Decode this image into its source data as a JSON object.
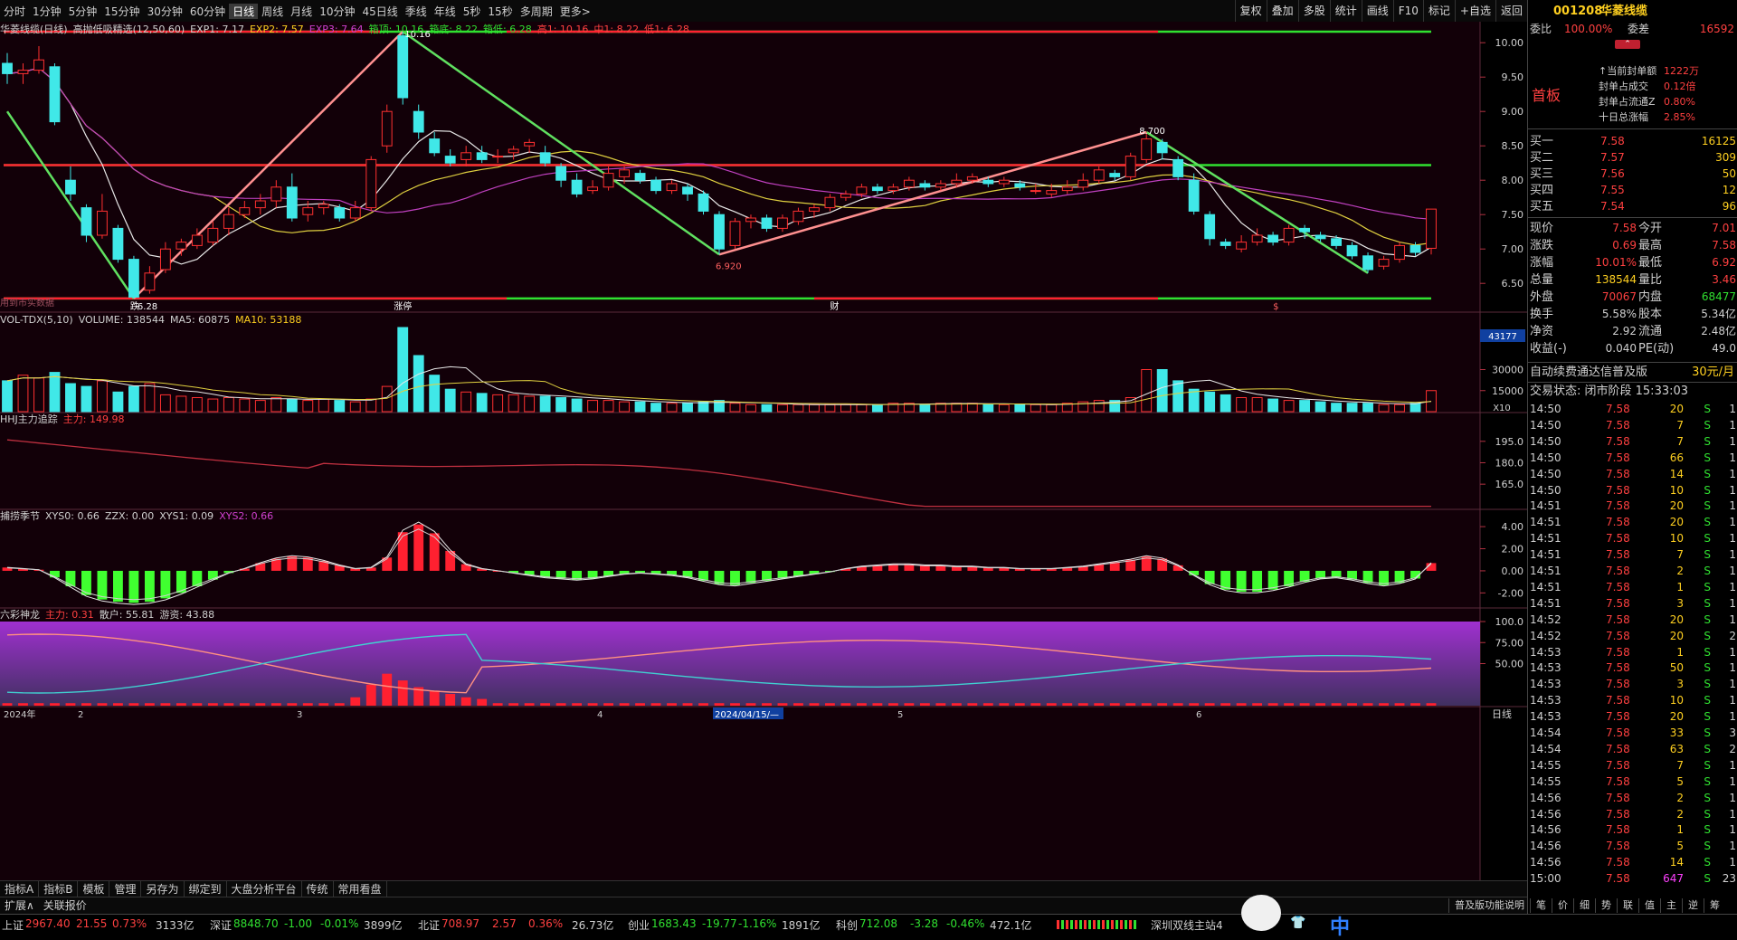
{
  "topbar": {
    "timeframes": [
      "分时",
      "1分钟",
      "5分钟",
      "15分钟",
      "30分钟",
      "60分钟",
      "日线",
      "周线",
      "月线",
      "10分钟",
      "45日线",
      "季线",
      "年线",
      "5秒",
      "15秒",
      "多周期",
      "更多>"
    ],
    "active": "日线",
    "tools": [
      "复权",
      "叠加",
      "多股",
      "统计",
      "画线",
      "F10",
      "标记",
      "+自选",
      "返回"
    ]
  },
  "main": {
    "title_parts": [
      {
        "text": "华菱线缆(日线)",
        "color": "#d0d0d0"
      },
      {
        "text": "高抛低吸精选(12,50,60)",
        "color": "#d0d0d0"
      },
      {
        "text": "EXP1: 7.17",
        "color": "#d0d0d0"
      },
      {
        "text": "EXP2: 7.57",
        "color": "#ffd020"
      },
      {
        "text": "EXP3: 7.64",
        "color": "#d040d0"
      },
      {
        "text": "箱顶: 10.16",
        "color": "#30e030"
      },
      {
        "text": "箱底: 8.22",
        "color": "#30e030"
      },
      {
        "text": "箱低: 6.28",
        "color": "#30e030"
      },
      {
        "text": "高1: 10.16",
        "color": "#ff4040"
      },
      {
        "text": "中1: 8.22",
        "color": "#ff4040"
      },
      {
        "text": "低1: 6.28",
        "color": "#ff4040"
      }
    ],
    "price_ticks": [
      "10.00",
      "9.50",
      "9.00",
      "8.50",
      "8.00",
      "7.50",
      "7.00",
      "6.50"
    ],
    "annotations": {
      "high": "10.16",
      "low": "6.28",
      "mid_low": "6.920",
      "right_high": "8.700",
      "left_label": "用到市实数据",
      "marker_die": "跌",
      "marker_zt": "涨停",
      "marker_cai": "财",
      "marker_s": "$"
    }
  },
  "vol": {
    "title_parts": [
      {
        "text": "VOL-TDX(5,10)",
        "color": "#d0d0d0"
      },
      {
        "text": "VOLUME: 138544",
        "color": "#d0d0d0"
      },
      {
        "text": "MA5: 60875",
        "color": "#d0d0d0"
      },
      {
        "text": "MA10: 53188",
        "color": "#ffd020"
      }
    ],
    "ticks": [
      "30000",
      "15000"
    ],
    "badge": "43177",
    "unit": "X10"
  },
  "hhj": {
    "title_parts": [
      {
        "text": "HHJ主力追踪",
        "color": "#d0d0d0"
      },
      {
        "text": "主力: 149.98",
        "color": "#ff4040"
      }
    ],
    "ticks": [
      "195.0",
      "180.0",
      "165.0"
    ]
  },
  "season": {
    "title_parts": [
      {
        "text": "捕捞季节",
        "color": "#d0d0d0"
      },
      {
        "text": "XYS0: 0.66",
        "color": "#d0d0d0"
      },
      {
        "text": "ZZX: 0.00",
        "color": "#d0d0d0"
      },
      {
        "text": "XYS1: 0.09",
        "color": "#d0d0d0"
      },
      {
        "text": "XYS2: 0.66",
        "color": "#d040d0"
      }
    ],
    "ticks": [
      "4.00",
      "2.00",
      "0.00",
      "-2.00"
    ]
  },
  "six": {
    "title_parts": [
      {
        "text": "六彩神龙",
        "color": "#d0d0d0"
      },
      {
        "text": "主力: 0.31",
        "color": "#ff4040"
      },
      {
        "text": "散户: 55.81",
        "color": "#d0d0d0"
      },
      {
        "text": "游资: 43.88",
        "color": "#d0d0d0"
      }
    ],
    "ticks": [
      "100.0",
      "75.00",
      "50.00"
    ]
  },
  "xaxis": {
    "labels": [
      "2024年",
      "2",
      "3",
      "4",
      "2024/04/15/—",
      "5",
      "6"
    ],
    "period": "日线"
  },
  "tabs": [
    "指标A",
    "指标B",
    "模板",
    "管理",
    "另存为",
    "绑定到",
    "大盘分析平台",
    "传统",
    "常用看盘"
  ],
  "tabs2": [
    "扩展∧",
    "关联报价"
  ],
  "right": {
    "code": "001208",
    "name": "华菱线缆",
    "weibi_label": "委比",
    "weibi": "100.00%",
    "weicha_label": "委差",
    "weicha": "16592",
    "board": "首板",
    "seal": [
      {
        "label": "当前封单额",
        "value": "1222万"
      },
      {
        "label": "封单占成交",
        "value": "0.12倍"
      },
      {
        "label": "封单占流通Z",
        "value": "0.80%"
      },
      {
        "label": "十日总涨幅",
        "value": "2.85%"
      }
    ],
    "buys": [
      {
        "label": "买一",
        "price": "7.58",
        "vol": "16125"
      },
      {
        "label": "买二",
        "price": "7.57",
        "vol": "309"
      },
      {
        "label": "买三",
        "price": "7.56",
        "vol": "50"
      },
      {
        "label": "买四",
        "price": "7.55",
        "vol": "12"
      },
      {
        "label": "买五",
        "price": "7.54",
        "vol": "96"
      }
    ],
    "quote": [
      {
        "l1": "现价",
        "v1": "7.58",
        "c1": "#ff4040",
        "l2": "今开",
        "v2": "7.01",
        "c2": "#ff4040"
      },
      {
        "l1": "涨跌",
        "v1": "0.69",
        "c1": "#ff4040",
        "l2": "最高",
        "v2": "7.58",
        "c2": "#ff4040"
      },
      {
        "l1": "涨幅",
        "v1": "10.01%",
        "c1": "#ff4040",
        "l2": "最低",
        "v2": "6.92",
        "c2": "#ff4040"
      },
      {
        "l1": "总量",
        "v1": "138544",
        "c1": "#ffd020",
        "l2": "量比",
        "v2": "3.46",
        "c2": "#ff4040"
      },
      {
        "l1": "外盘",
        "v1": "70067",
        "c1": "#ff4040",
        "l2": "内盘",
        "v2": "68477",
        "c2": "#30e030"
      },
      {
        "l1": "换手",
        "v1": "5.58%",
        "c1": "#d0d0d0",
        "l2": "股本",
        "v2": "5.34亿",
        "c2": "#d0d0d0"
      },
      {
        "l1": "净资",
        "v1": "2.92",
        "c1": "#d0d0d0",
        "l2": "流通",
        "v2": "2.48亿",
        "c2": "#d0d0d0"
      },
      {
        "l1": "收益(-)",
        "v1": "0.040",
        "c1": "#d0d0d0",
        "l2": "PE(动)",
        "v2": "49.0",
        "c2": "#d0d0d0"
      }
    ],
    "promo": "自动续费通达信普及版",
    "promo_price": "30元/月",
    "status": "交易状态: 闭市阶段 15:33:03",
    "ticks": [
      {
        "t": "14:50",
        "p": "7.58",
        "v": "20",
        "s": "S",
        "n": "1"
      },
      {
        "t": "14:50",
        "p": "7.58",
        "v": "7",
        "s": "S",
        "n": "1"
      },
      {
        "t": "14:50",
        "p": "7.58",
        "v": "7",
        "s": "S",
        "n": "1"
      },
      {
        "t": "14:50",
        "p": "7.58",
        "v": "66",
        "s": "S",
        "n": "1"
      },
      {
        "t": "14:50",
        "p": "7.58",
        "v": "14",
        "s": "S",
        "n": "1"
      },
      {
        "t": "14:50",
        "p": "7.58",
        "v": "10",
        "s": "S",
        "n": "1"
      },
      {
        "t": "14:51",
        "p": "7.58",
        "v": "20",
        "s": "S",
        "n": "1"
      },
      {
        "t": "14:51",
        "p": "7.58",
        "v": "20",
        "s": "S",
        "n": "1"
      },
      {
        "t": "14:51",
        "p": "7.58",
        "v": "10",
        "s": "S",
        "n": "1"
      },
      {
        "t": "14:51",
        "p": "7.58",
        "v": "7",
        "s": "S",
        "n": "1"
      },
      {
        "t": "14:51",
        "p": "7.58",
        "v": "2",
        "s": "S",
        "n": "1"
      },
      {
        "t": "14:51",
        "p": "7.58",
        "v": "1",
        "s": "S",
        "n": "1"
      },
      {
        "t": "14:51",
        "p": "7.58",
        "v": "3",
        "s": "S",
        "n": "1"
      },
      {
        "t": "14:52",
        "p": "7.58",
        "v": "20",
        "s": "S",
        "n": "1"
      },
      {
        "t": "14:52",
        "p": "7.58",
        "v": "20",
        "s": "S",
        "n": "2"
      },
      {
        "t": "14:53",
        "p": "7.58",
        "v": "1",
        "s": "S",
        "n": "1"
      },
      {
        "t": "14:53",
        "p": "7.58",
        "v": "50",
        "s": "S",
        "n": "1"
      },
      {
        "t": "14:53",
        "p": "7.58",
        "v": "3",
        "s": "S",
        "n": "1"
      },
      {
        "t": "14:53",
        "p": "7.58",
        "v": "10",
        "s": "S",
        "n": "1"
      },
      {
        "t": "14:53",
        "p": "7.58",
        "v": "20",
        "s": "S",
        "n": "1"
      },
      {
        "t": "14:54",
        "p": "7.58",
        "v": "33",
        "s": "S",
        "n": "3"
      },
      {
        "t": "14:54",
        "p": "7.58",
        "v": "63",
        "s": "S",
        "n": "2"
      },
      {
        "t": "14:55",
        "p": "7.58",
        "v": "7",
        "s": "S",
        "n": "1"
      },
      {
        "t": "14:55",
        "p": "7.58",
        "v": "5",
        "s": "S",
        "n": "1"
      },
      {
        "t": "14:56",
        "p": "7.58",
        "v": "2",
        "s": "S",
        "n": "1"
      },
      {
        "t": "14:56",
        "p": "7.58",
        "v": "2",
        "s": "S",
        "n": "1"
      },
      {
        "t": "14:56",
        "p": "7.58",
        "v": "1",
        "s": "S",
        "n": "1"
      },
      {
        "t": "14:56",
        "p": "7.58",
        "v": "5",
        "s": "S",
        "n": "1"
      },
      {
        "t": "14:56",
        "p": "7.58",
        "v": "14",
        "s": "S",
        "n": "1"
      },
      {
        "t": "15:00",
        "p": "7.58",
        "v": "647",
        "s": "S",
        "n": "23"
      }
    ],
    "func_tabs": [
      "普及版功能说明",
      "笔",
      "价",
      "细",
      "势",
      "联",
      "值",
      "主",
      "逆",
      "筹"
    ]
  },
  "bottom": [
    {
      "label": "上证",
      "value": "2967.40",
      "chg": "21.55",
      "pct": "0.73%",
      "amt": "3133亿",
      "color": "#ff4040"
    },
    {
      "label": "深证",
      "value": "8848.70",
      "chg": "-1.00",
      "pct": "-0.01%",
      "amt": "3899亿",
      "color": "#30e030"
    },
    {
      "label": "北证",
      "value": "708.97",
      "chg": "2.57",
      "pct": "0.36%",
      "amt": "26.73亿",
      "color": "#ff4040"
    },
    {
      "label": "创业",
      "value": "1683.43",
      "chg": "-19.77",
      "pct": "-1.16%",
      "amt": "1891亿",
      "color": "#30e030"
    },
    {
      "label": "科创",
      "value": "712.08",
      "chg": "-3.28",
      "pct": "-0.46%",
      "amt": "472.1亿",
      "color": "#30e030"
    }
  ],
  "bottom_extra": "深圳双线主站4",
  "bottom_ime": "中",
  "chart_data": {
    "type": "candlestick",
    "title": "华菱线缆(日线)",
    "ylim": [
      6.2,
      10.2
    ],
    "box": {
      "top": 10.16,
      "mid": 8.22,
      "low": 6.28
    },
    "candles": [
      [
        9.7,
        9.55,
        9.85,
        9.4
      ],
      [
        9.55,
        9.6,
        9.7,
        9.4
      ],
      [
        9.6,
        9.75,
        9.95,
        9.55
      ],
      [
        9.65,
        8.85,
        9.7,
        8.8
      ],
      [
        8.0,
        7.8,
        8.2,
        7.7
      ],
      [
        7.6,
        7.2,
        7.65,
        7.1
      ],
      [
        7.2,
        7.55,
        7.8,
        7.15
      ],
      [
        7.3,
        6.85,
        7.35,
        6.8
      ],
      [
        6.85,
        6.3,
        6.9,
        6.28
      ],
      [
        6.4,
        6.65,
        6.75,
        6.35
      ],
      [
        6.7,
        7.0,
        7.1,
        6.65
      ],
      [
        7.0,
        7.1,
        7.15,
        6.9
      ],
      [
        7.05,
        7.2,
        7.3,
        7.0
      ],
      [
        7.1,
        7.3,
        7.4,
        7.05
      ],
      [
        7.3,
        7.5,
        7.6,
        7.2
      ],
      [
        7.5,
        7.6,
        7.7,
        7.45
      ],
      [
        7.6,
        7.7,
        7.8,
        7.5
      ],
      [
        7.7,
        7.9,
        8.0,
        7.6
      ],
      [
        7.9,
        7.45,
        8.1,
        7.4
      ],
      [
        7.5,
        7.6,
        7.7,
        7.4
      ],
      [
        7.6,
        7.65,
        7.7,
        7.5
      ],
      [
        7.6,
        7.45,
        7.65,
        7.4
      ],
      [
        7.45,
        7.6,
        7.7,
        7.4
      ],
      [
        7.6,
        8.3,
        8.35,
        7.55
      ],
      [
        8.5,
        9.0,
        9.1,
        8.4
      ],
      [
        10.1,
        9.2,
        10.16,
        9.1
      ],
      [
        9.0,
        8.7,
        9.1,
        8.6
      ],
      [
        8.6,
        8.4,
        8.7,
        8.35
      ],
      [
        8.35,
        8.25,
        8.45,
        8.2
      ],
      [
        8.3,
        8.4,
        8.5,
        8.2
      ],
      [
        8.4,
        8.3,
        8.5,
        8.25
      ],
      [
        8.35,
        8.35,
        8.45,
        8.25
      ],
      [
        8.4,
        8.45,
        8.5,
        8.3
      ],
      [
        8.5,
        8.55,
        8.6,
        8.4
      ],
      [
        8.4,
        8.25,
        8.5,
        8.2
      ],
      [
        8.2,
        8.0,
        8.25,
        7.9
      ],
      [
        8.0,
        7.8,
        8.1,
        7.75
      ],
      [
        7.85,
        7.9,
        8.0,
        7.8
      ],
      [
        7.9,
        8.1,
        8.2,
        7.85
      ],
      [
        8.05,
        8.15,
        8.2,
        7.95
      ],
      [
        8.1,
        8.0,
        8.15,
        7.95
      ],
      [
        8.0,
        7.85,
        8.05,
        7.8
      ],
      [
        7.85,
        7.95,
        8.0,
        7.8
      ],
      [
        7.9,
        7.8,
        7.95,
        7.7
      ],
      [
        7.8,
        7.55,
        7.85,
        7.5
      ],
      [
        7.5,
        7.0,
        7.55,
        6.92
      ],
      [
        7.05,
        7.4,
        7.45,
        7.0
      ],
      [
        7.4,
        7.45,
        7.5,
        7.3
      ],
      [
        7.45,
        7.3,
        7.5,
        7.25
      ],
      [
        7.3,
        7.45,
        7.5,
        7.25
      ],
      [
        7.4,
        7.55,
        7.6,
        7.35
      ],
      [
        7.55,
        7.6,
        7.65,
        7.45
      ],
      [
        7.6,
        7.75,
        7.8,
        7.55
      ],
      [
        7.75,
        7.8,
        7.85,
        7.7
      ],
      [
        7.8,
        7.9,
        7.95,
        7.75
      ],
      [
        7.9,
        7.85,
        7.95,
        7.8
      ],
      [
        7.85,
        7.9,
        7.95,
        7.8
      ],
      [
        7.9,
        8.0,
        8.05,
        7.85
      ],
      [
        7.95,
        7.9,
        8.0,
        7.85
      ],
      [
        7.9,
        7.95,
        8.0,
        7.85
      ],
      [
        7.95,
        8.0,
        8.1,
        7.9
      ],
      [
        8.0,
        8.05,
        8.1,
        7.95
      ],
      [
        8.0,
        7.95,
        8.05,
        7.9
      ],
      [
        7.95,
        8.0,
        8.05,
        7.9
      ],
      [
        7.95,
        7.9,
        8.0,
        7.85
      ],
      [
        7.85,
        7.85,
        7.95,
        7.8
      ],
      [
        7.8,
        7.85,
        7.95,
        7.75
      ],
      [
        7.85,
        7.9,
        8.0,
        7.8
      ],
      [
        7.9,
        8.0,
        8.1,
        7.85
      ],
      [
        8.0,
        8.15,
        8.2,
        7.95
      ],
      [
        8.1,
        8.05,
        8.15,
        8.0
      ],
      [
        8.05,
        8.35,
        8.4,
        8.0
      ],
      [
        8.3,
        8.6,
        8.7,
        8.25
      ],
      [
        8.55,
        8.4,
        8.6,
        8.3
      ],
      [
        8.3,
        8.05,
        8.35,
        8.0
      ],
      [
        8.0,
        7.55,
        8.1,
        7.5
      ],
      [
        7.5,
        7.15,
        7.55,
        7.05
      ],
      [
        7.1,
        7.05,
        7.15,
        7.0
      ],
      [
        7.0,
        7.1,
        7.2,
        6.95
      ],
      [
        7.1,
        7.2,
        7.3,
        7.05
      ],
      [
        7.2,
        7.1,
        7.25,
        7.05
      ],
      [
        7.1,
        7.3,
        7.35,
        7.05
      ],
      [
        7.3,
        7.25,
        7.35,
        7.15
      ],
      [
        7.2,
        7.15,
        7.25,
        7.1
      ],
      [
        7.15,
        7.05,
        7.2,
        7.0
      ],
      [
        7.05,
        6.9,
        7.1,
        6.85
      ],
      [
        6.9,
        6.7,
        6.95,
        6.65
      ],
      [
        6.75,
        6.85,
        6.9,
        6.7
      ],
      [
        6.85,
        7.05,
        7.1,
        6.8
      ],
      [
        7.05,
        6.95,
        7.1,
        6.9
      ],
      [
        7.01,
        7.58,
        7.58,
        6.92
      ]
    ],
    "volume_max": 60000,
    "volumes": [
      22000,
      26000,
      24000,
      28000,
      20000,
      18000,
      22000,
      14000,
      18000,
      20000,
      12000,
      11000,
      10000,
      9000,
      10000,
      9000,
      8000,
      10000,
      9000,
      8000,
      9000,
      8000,
      7000,
      9000,
      18000,
      60000,
      40000,
      26000,
      16000,
      14000,
      13000,
      12000,
      12000,
      11000,
      11000,
      10000,
      9000,
      8000,
      8000,
      7000,
      7000,
      6000,
      6000,
      6000,
      7000,
      8000,
      6000,
      5000,
      5000,
      5000,
      5000,
      5000,
      5000,
      5000,
      5000,
      5000,
      6000,
      6000,
      5000,
      6000,
      6000,
      6000,
      5000,
      5000,
      5000,
      5000,
      5000,
      6000,
      7000,
      8000,
      8000,
      10000,
      30000,
      30000,
      22000,
      16000,
      14000,
      12000,
      10000,
      10000,
      9000,
      8000,
      8000,
      7000,
      6000,
      6000,
      6000,
      5000,
      5000,
      6000,
      15000
    ],
    "hhj_ylim": [
      148,
      205
    ],
    "season_ylim": [
      -3.2,
      4.5
    ],
    "six_ylim": [
      0,
      100
    ]
  }
}
